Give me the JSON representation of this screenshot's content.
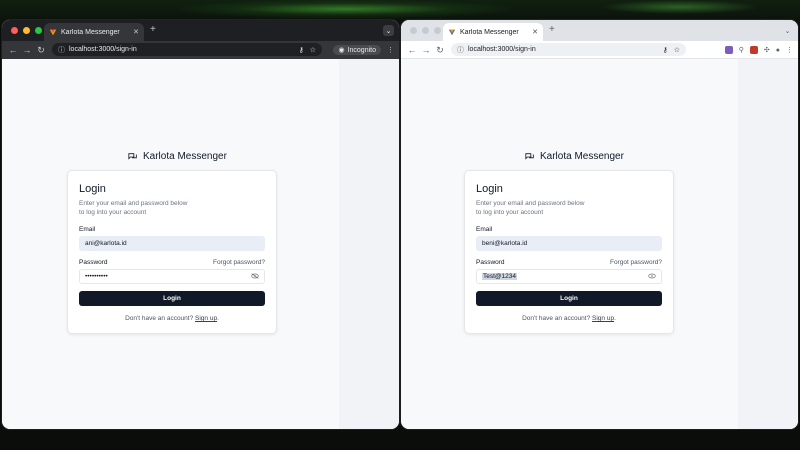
{
  "left_window": {
    "tab_title": "Karlota Messenger",
    "new_tab_symbol": "+",
    "url": "localhost:3000/sign-in",
    "incognito_label": "Incognito",
    "login": {
      "brand": "Karlota Messenger",
      "title": "Login",
      "description_line1": "Enter your email and password below",
      "description_line2": "to log into your account",
      "email_label": "Email",
      "email_value": "ani@karlota.id",
      "password_label": "Password",
      "forgot_label": "Forgot password?",
      "password_value": "••••••••••",
      "login_button": "Login",
      "signup_prompt": "Don't have an account?",
      "signup_link": "Sign up",
      "signup_period": "."
    }
  },
  "right_window": {
    "tab_title": "Karlota Messenger",
    "new_tab_symbol": "+",
    "url": "localhost:3000/sign-in",
    "login": {
      "brand": "Karlota Messenger",
      "title": "Login",
      "description_line1": "Enter your email and password below",
      "description_line2": "to log into your account",
      "email_label": "Email",
      "email_value": "beni@karlota.id",
      "password_label": "Password",
      "forgot_label": "Forgot password?",
      "password_value": "Test@1234",
      "login_button": "Login",
      "signup_prompt": "Don't have an account?",
      "signup_link": "Sign up",
      "signup_period": "."
    }
  },
  "icons": {
    "back": "back-arrow-icon",
    "forward": "forward-arrow-icon",
    "reload": "reload-icon",
    "eye_closed": "eye-off-icon",
    "eye_open": "eye-icon"
  },
  "colors": {
    "primary_button": "#111827",
    "incognito_chrome": "#35363a",
    "normal_chrome": "#dfe3e8",
    "email_field_bg": "#e8edf6"
  }
}
